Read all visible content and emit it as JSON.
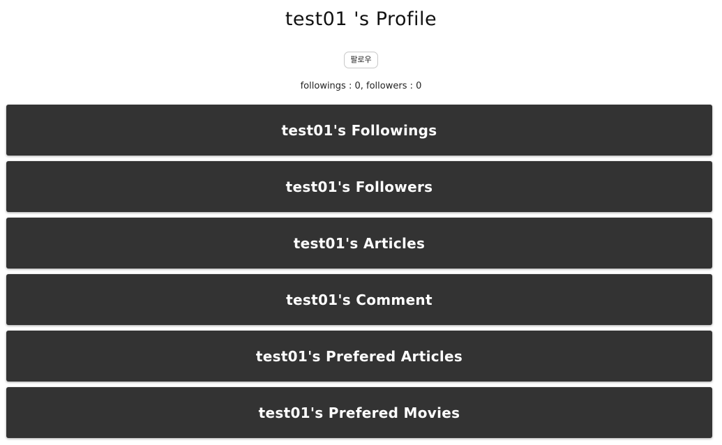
{
  "profile": {
    "title": "test01 's Profile",
    "follow_button": "팔로우",
    "counts": "followings : 0, followers : 0"
  },
  "sections": [
    {
      "label": "test01's Followings"
    },
    {
      "label": "test01's Followers"
    },
    {
      "label": "test01's Articles"
    },
    {
      "label": "test01's Comment"
    },
    {
      "label": "test01's Prefered Articles"
    },
    {
      "label": "test01's Prefered Movies"
    }
  ],
  "colors": {
    "section_background": "#333333",
    "section_text": "#ffffff",
    "page_background": "#ffffff"
  }
}
